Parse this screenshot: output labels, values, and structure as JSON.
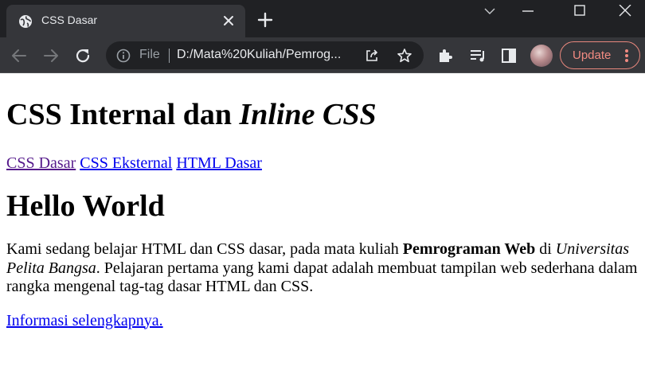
{
  "browser": {
    "tab_title": "CSS Dasar",
    "omnibox_scheme": "File",
    "url": "D:/Mata%20Kuliah/Pemrog...",
    "update_label": "Update",
    "icons": {
      "favicon": "globe-icon",
      "close": "close-icon",
      "new_tab": "plus-icon",
      "tab_search": "chevron-down-icon",
      "minimize": "minimize-icon",
      "maximize": "maximize-icon",
      "window_close": "close-icon",
      "back": "back-arrow-icon",
      "forward": "forward-arrow-icon",
      "reload": "reload-icon",
      "info": "info-icon",
      "share": "share-icon",
      "bookmark": "star-icon",
      "extensions": "puzzle-icon",
      "media": "playlist-icon",
      "side_panel": "side-panel-icon",
      "menu": "more-vertical-icon"
    },
    "colors": {
      "titlebar": "#202124",
      "toolbar": "#35363a",
      "update_accent": "#f28b82"
    }
  },
  "page": {
    "title_plain": "CSS Internal dan ",
    "title_italic": "Inline CSS",
    "nav": [
      {
        "label": "CSS Dasar",
        "visited": true
      },
      {
        "label": "CSS Eksternal",
        "visited": false
      },
      {
        "label": "HTML Dasar",
        "visited": false
      }
    ],
    "heading": "Hello World",
    "paragraph": {
      "part1": "Kami sedang belajar HTML dan CSS dasar, pada mata kuliah ",
      "bold": "Pemrograman Web",
      "part2": " di ",
      "italic": "Universitas Pelita Bangsa",
      "part3": ". Pelajaran pertama yang kami dapat adalah membuat tampilan web sederhana dalam rangka mengenal tag-tag dasar HTML dan CSS."
    },
    "more_link": "Informasi selengkapnya.",
    "colors": {
      "link": "#0000ee",
      "visited_link": "#551a8b"
    }
  }
}
